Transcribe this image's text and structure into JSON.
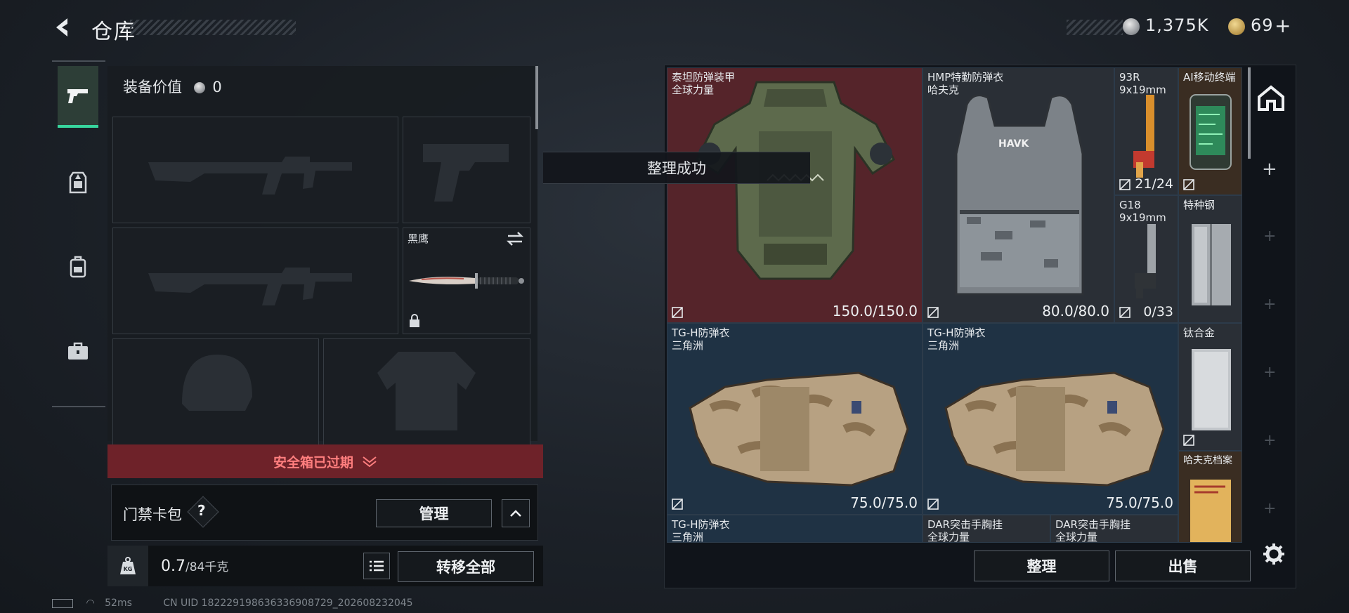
{
  "header": {
    "title": "仓库"
  },
  "currency": {
    "silver_amount": "1,375K",
    "gold_amount": "69",
    "gold_plus": "+",
    "silver_icon": "silver-coin-icon",
    "gold_icon": "gold-coin-icon"
  },
  "nav": {
    "items": [
      {
        "icon": "pistol-icon",
        "active": true
      },
      {
        "icon": "chest-rig-icon",
        "active": false
      },
      {
        "icon": "backpack-icon",
        "active": false
      },
      {
        "icon": "briefcase-icon",
        "active": false
      }
    ]
  },
  "equipment": {
    "value_label": "装备价值",
    "value": "0",
    "knife_label": "黑鹰"
  },
  "safebox": {
    "expired_text": "安全箱已过期"
  },
  "card_pack": {
    "label": "门禁卡包",
    "help": "?",
    "manage_button": "管理"
  },
  "weight": {
    "current": "0.7",
    "max": "/84千克",
    "transfer_all_button": "转移全部",
    "kg_icon_text": "KG"
  },
  "toast": {
    "text": "整理成功"
  },
  "stash_items": [
    {
      "name1": "泰坦防弹装甲",
      "name2": "全球力量",
      "durability": "150.0/150.0"
    },
    {
      "name1": "HMP特勤防弹衣",
      "name2": "哈夫克",
      "durability": "80.0/80.0",
      "logo_text": "HAVK"
    },
    {
      "name1": "93R",
      "name2": "9x19mm",
      "ammo": "21/24"
    },
    {
      "name1": "AI移动终端",
      "name2": ""
    },
    {
      "name1": "G18",
      "name2": "9x19mm",
      "ammo": "0/33"
    },
    {
      "name1": "特种钢",
      "name2": ""
    },
    {
      "name1": "TG-H防弹衣",
      "name2": "三角洲",
      "durability": "75.0/75.0"
    },
    {
      "name1": "TG-H防弹衣",
      "name2": "三角洲",
      "durability": "75.0/75.0"
    },
    {
      "name1": "钛合金",
      "name2": ""
    },
    {
      "name1": "哈夫克档案",
      "name2": ""
    },
    {
      "name1": "TG-H防弹衣",
      "name2": "三角洲"
    },
    {
      "name1": "DAR突击手胸挂",
      "name2": "全球力量"
    },
    {
      "name1": "DAR突击手胸挂",
      "name2": "全球力量"
    }
  ],
  "stash_buttons": {
    "sort": "整理",
    "sell": "出售"
  },
  "status_bar": {
    "ping": "52ms",
    "uid": "CN UID 1822291986363369087​29_202608232045"
  },
  "colors": {
    "accent_green": "#37d59d",
    "expired_red": "#6e2229",
    "cell_red": "#55242a",
    "cell_blue": "#1f3244"
  }
}
